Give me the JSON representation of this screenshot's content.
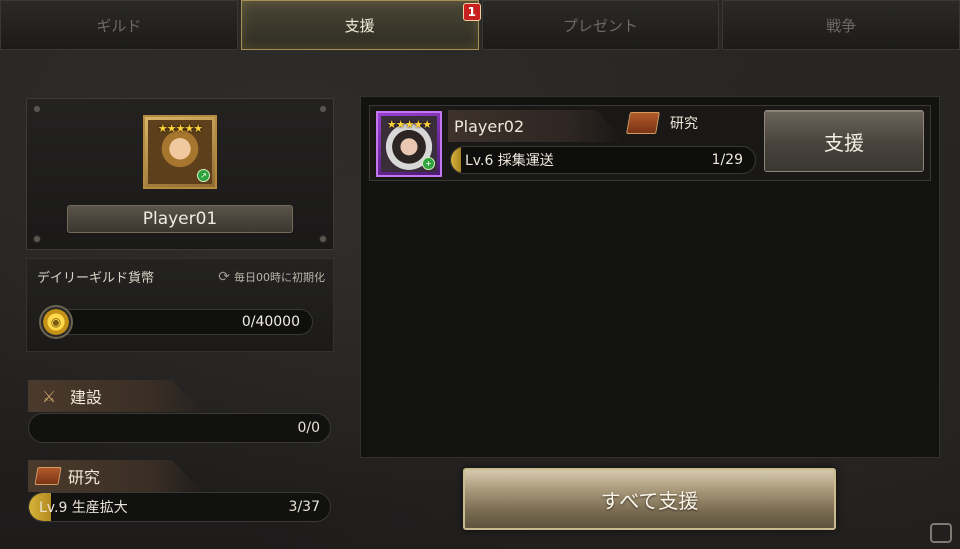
{
  "tabs": [
    {
      "label": "ギルド"
    },
    {
      "label": "支援",
      "badge": "1"
    },
    {
      "label": "プレゼント"
    },
    {
      "label": "戦争"
    }
  ],
  "profile": {
    "stars": "★★★★★",
    "name": "Player01"
  },
  "daily": {
    "title": "デイリーギルド貨幣",
    "reset_label": "毎日00時に初期化",
    "coin_value": "0/40000"
  },
  "construction": {
    "title": "建設",
    "value": "0/0"
  },
  "research": {
    "title": "研究",
    "item": "Lv.9 生産拡大",
    "value": "3/37"
  },
  "request": {
    "player_name": "Player02",
    "stars": "★★★★★",
    "category": "研究",
    "item": "Lv.6 採集運送",
    "value": "1/29",
    "progress": 0.034,
    "support_label": "支援"
  },
  "support_all_label": "すべて支援",
  "colors": {
    "accent_gold": "#a58f55",
    "badge_red": "#c7201f",
    "progress_gold": "#d7b33a"
  }
}
